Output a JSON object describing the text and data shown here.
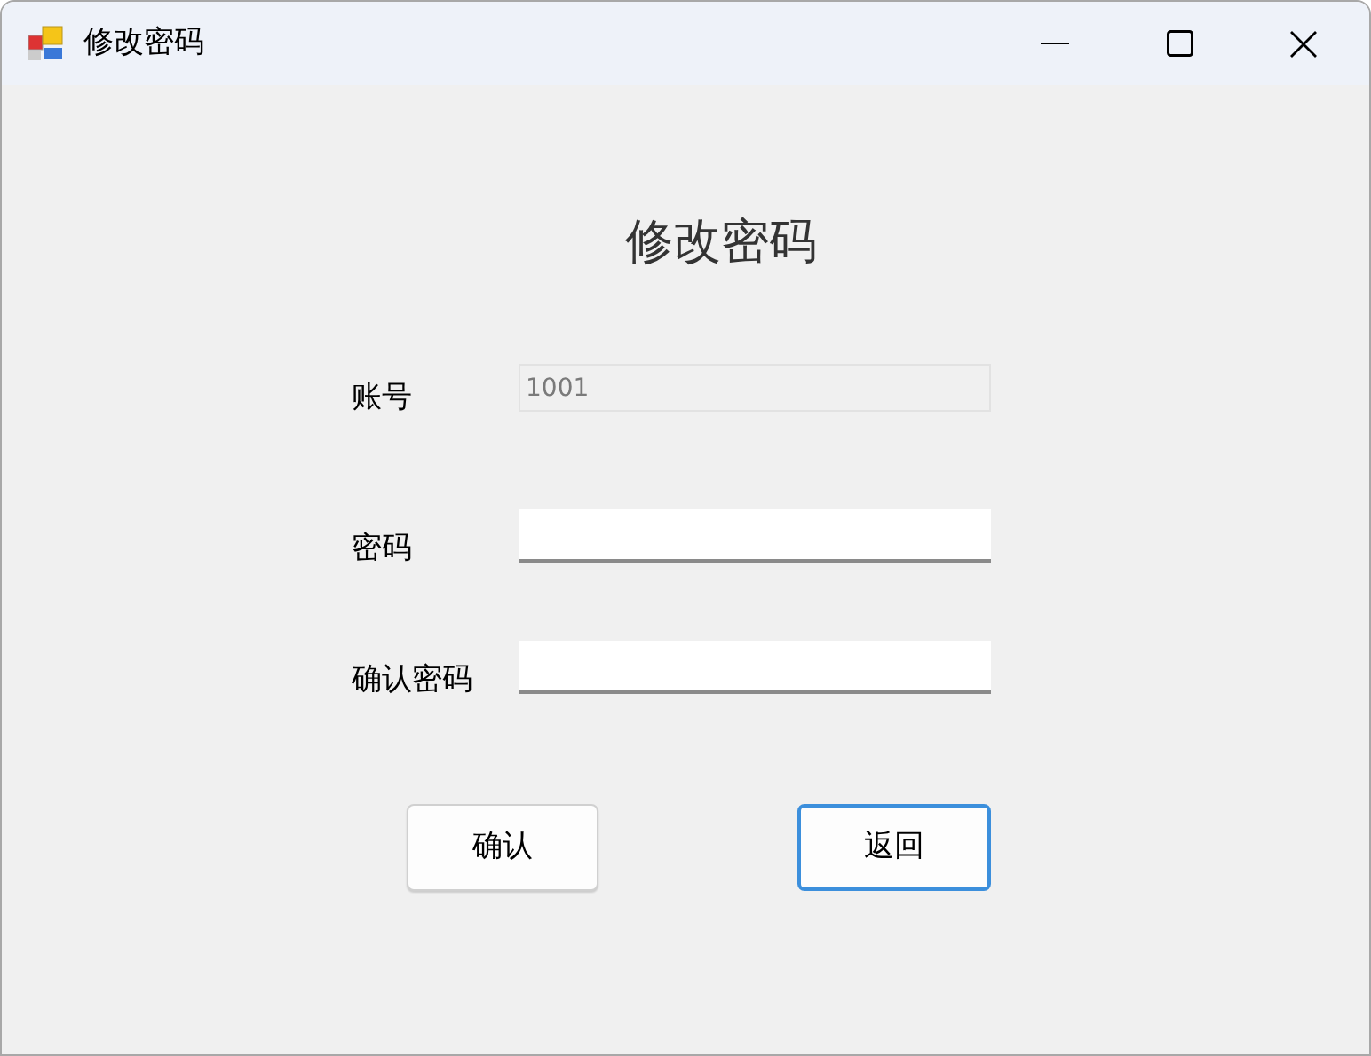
{
  "window": {
    "title": "修改密码"
  },
  "heading": "修改密码",
  "fields": [
    {
      "label": "账号",
      "value": "1001",
      "disabled": true
    },
    {
      "label": "密码",
      "disabled": false
    },
    {
      "label": "确认密码",
      "disabled": false
    }
  ],
  "buttons": [
    {
      "label": "确认",
      "focused": false
    },
    {
      "label": "返回",
      "focused": true
    }
  ]
}
